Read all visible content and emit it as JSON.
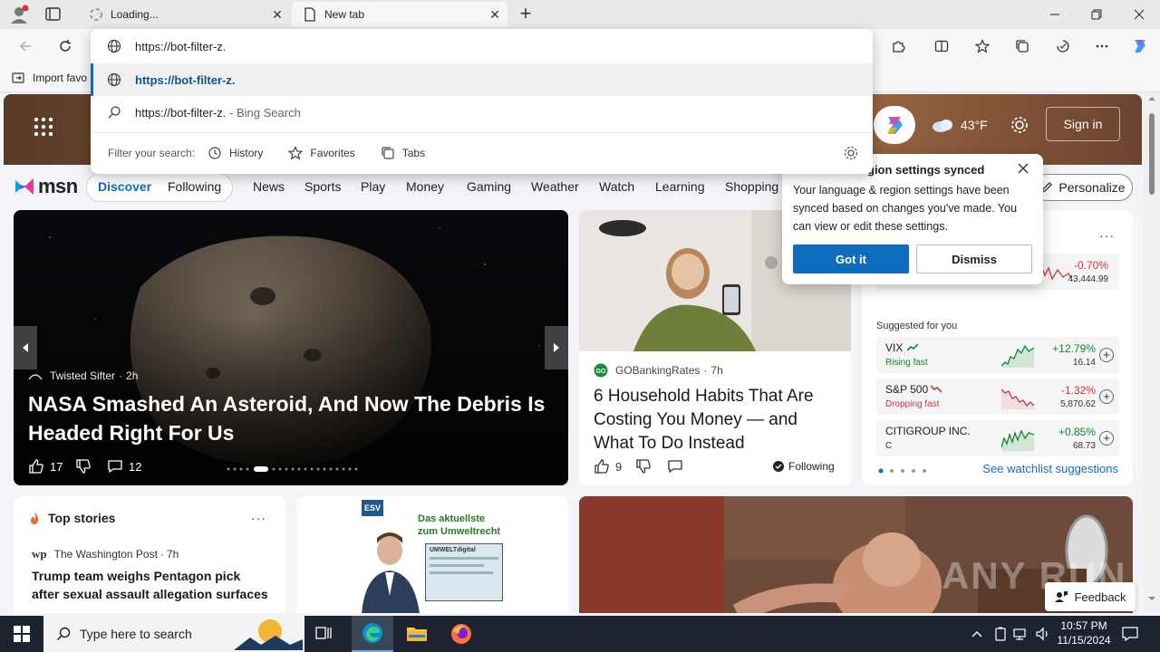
{
  "tabs": [
    {
      "label": "Loading..."
    },
    {
      "label": "New tab"
    }
  ],
  "address": {
    "value": "https://bot-filter-z."
  },
  "omnibox": {
    "suggestion_url": "https://bot-filter-z.",
    "search_text": "https://bot-filter-z.",
    "search_suffix": " - Bing Search",
    "filter_label": "Filter your search:",
    "filters": [
      "History",
      "Favorites",
      "Tabs"
    ]
  },
  "favorites": {
    "import_label": "Import favo"
  },
  "weather": {
    "temp": "43°F"
  },
  "header": {
    "signin": "Sign in"
  },
  "msn": {
    "logo": "msn"
  },
  "nav": {
    "discover": "Discover",
    "following": "Following",
    "items": [
      "News",
      "Sports",
      "Play",
      "Money",
      "Gaming",
      "Weather",
      "Watch",
      "Learning",
      "Shopping"
    ],
    "personalize": "Personalize"
  },
  "hero": {
    "source": "Twisted Sifter",
    "age": "2h",
    "title": "NASA Smashed An Asteroid, And Now The Debris Is Headed Right For Us",
    "likes": "17",
    "comments": "12"
  },
  "article2": {
    "source": "GOBankingRates",
    "age": "7h",
    "title": "6 Household Habits That Are Costing You Money — and What To Do Instead",
    "likes": "9",
    "following": "Following"
  },
  "popup": {
    "title": "gion settings synced",
    "body": "Your language & region settings have been synced based on changes you've made. You can view or edit these settings.",
    "got_it": "Got it",
    "dismiss": "Dismiss"
  },
  "watchlist": {
    "top_change": "-0.70%",
    "top_value": "43,444.99",
    "suggested": "Suggested for you",
    "stocks": [
      {
        "name": "VIX",
        "status": "Rising fast",
        "change": "+12.79%",
        "value": "16.14",
        "color": "#0b8a2c"
      },
      {
        "name": "S&P 500",
        "status": "Dropping fast",
        "change": "-1.32%",
        "value": "5,870.62",
        "color": "#d13438"
      },
      {
        "name": "CITIGROUP INC.",
        "status": "C",
        "change": "+0.85%",
        "value": "68.73",
        "color": "#0b8a2c"
      }
    ],
    "see_more": "See watchlist suggestions"
  },
  "topstories": {
    "title": "Top stories",
    "source": "The Washington Post",
    "age": "7h",
    "headline": "Trump team weighs Pentagon pick after sexual assault allegation surfaces"
  },
  "ad": {
    "brand": "ESV",
    "tagline": "Das aktuellste zum Umweltrecht",
    "product": "UMWELTdigital"
  },
  "feedback": {
    "label": "Feedback"
  },
  "watermark": "ANY RUN",
  "taskbar": {
    "search_placeholder": "Type here to search",
    "time": "10:57 PM",
    "date": "11/15/2024"
  },
  "colors": {
    "accent": "#0f6cbd",
    "button_blue": "#0f6cbd"
  }
}
